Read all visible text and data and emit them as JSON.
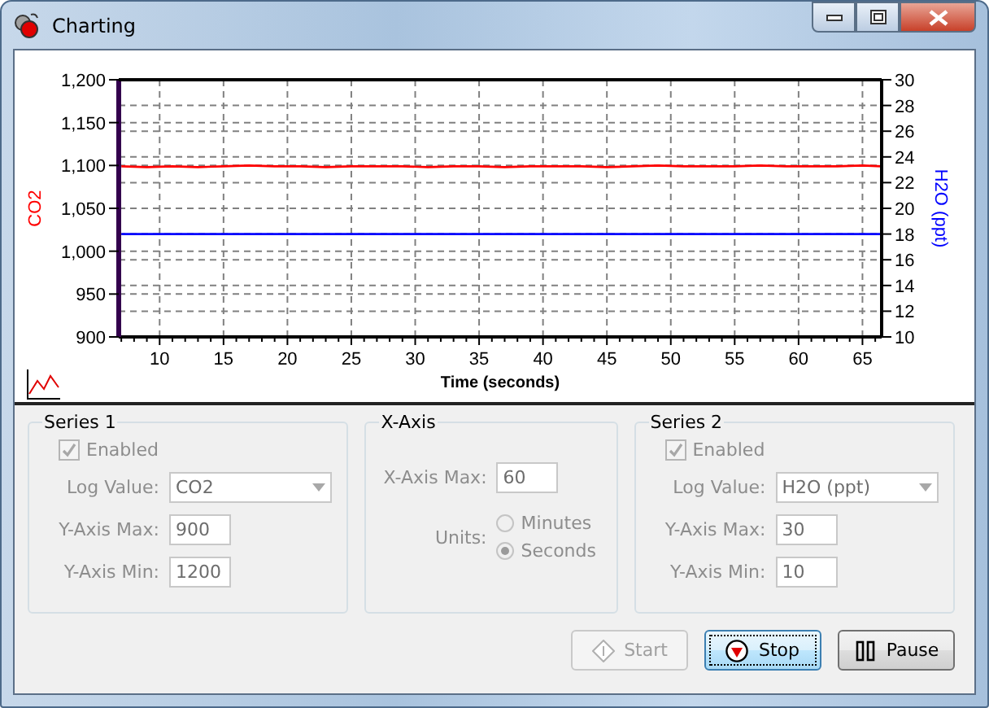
{
  "window": {
    "title": "Charting"
  },
  "chart": {
    "chart_data": {
      "type": "line",
      "xlabel": "Time (seconds)",
      "grid": true,
      "xlim": [
        6.8,
        66.5
      ],
      "ylim": [
        900,
        1200
      ],
      "y2lim": [
        10,
        30
      ],
      "xticks": [
        10,
        15,
        20,
        25,
        30,
        35,
        40,
        45,
        50,
        55,
        60,
        65
      ],
      "yticks": [
        {
          "value": 900,
          "label": "900"
        },
        {
          "value": 950,
          "label": "950"
        },
        {
          "value": 1000,
          "label": "1,000"
        },
        {
          "value": 1050,
          "label": "1,050"
        },
        {
          "value": 1100,
          "label": "1,100"
        },
        {
          "value": 1150,
          "label": "1,150"
        },
        {
          "value": 1200,
          "label": "1,200"
        }
      ],
      "y2ticks": [
        10,
        12,
        14,
        16,
        18,
        20,
        22,
        24,
        26,
        28,
        30
      ],
      "x": [
        7,
        9,
        11,
        13,
        15,
        17,
        19,
        21,
        23,
        25,
        27,
        29,
        31,
        33,
        35,
        37,
        39,
        41,
        43,
        45,
        47,
        49,
        51,
        53,
        55,
        57,
        59,
        61,
        63,
        65,
        66.5
      ],
      "series": [
        {
          "name": "CO2",
          "color": "#ff0000",
          "values": [
            1099,
            1098,
            1099,
            1098,
            1099,
            1100,
            1099,
            1099,
            1098,
            1099,
            1099,
            1099,
            1098,
            1099,
            1099,
            1098,
            1099,
            1099,
            1099,
            1098,
            1099,
            1100,
            1099,
            1099,
            1099,
            1100,
            1099,
            1099,
            1099,
            1100,
            1099
          ]
        },
        {
          "name": "H2O (ppt)",
          "color": "#0000ff",
          "axis": "y2",
          "values": [
            18,
            18,
            18,
            18,
            18,
            18,
            18,
            18,
            18,
            18,
            18,
            18,
            18,
            18,
            18,
            18,
            18,
            18,
            18,
            18,
            18,
            18,
            18,
            18,
            18,
            18,
            18,
            18,
            18,
            18,
            18
          ]
        }
      ]
    }
  },
  "groups": [
    {
      "kind": "series",
      "title": "Series 1",
      "enabled": {
        "label": "Enabled",
        "checked": true,
        "disabled": true
      },
      "log_value": {
        "label": "Log Value:",
        "value": "CO2",
        "disabled": true
      },
      "y_axis_max": {
        "label": "Y-Axis Max:",
        "value": "900",
        "disabled": true
      },
      "y_axis_min": {
        "label": "Y-Axis Min:",
        "value": "1200",
        "disabled": true
      }
    },
    {
      "kind": "x_axis",
      "title": "X-Axis",
      "x_axis_max": {
        "label": "X-Axis Max:",
        "value": "60",
        "disabled": true
      },
      "units": {
        "label": "Units:",
        "options": [
          {
            "label": "Minutes",
            "selected": false,
            "disabled": true
          },
          {
            "label": "Seconds",
            "selected": true,
            "disabled": true
          }
        ]
      }
    },
    {
      "kind": "series",
      "title": "Series 2",
      "enabled": {
        "label": "Enabled",
        "checked": true,
        "disabled": true
      },
      "log_value": {
        "label": "Log Value:",
        "value": "H2O (ppt)",
        "disabled": true
      },
      "y_axis_max": {
        "label": "Y-Axis Max:",
        "value": "30",
        "disabled": true
      },
      "y_axis_min": {
        "label": "Y-Axis Min:",
        "value": "10",
        "disabled": true
      }
    }
  ],
  "buttons": [
    {
      "kind": "start",
      "label": "Start",
      "disabled": true,
      "focused": false
    },
    {
      "kind": "stop",
      "label": "Stop",
      "disabled": false,
      "focused": true
    },
    {
      "kind": "pause",
      "label": "Pause",
      "disabled": false,
      "focused": false
    }
  ]
}
